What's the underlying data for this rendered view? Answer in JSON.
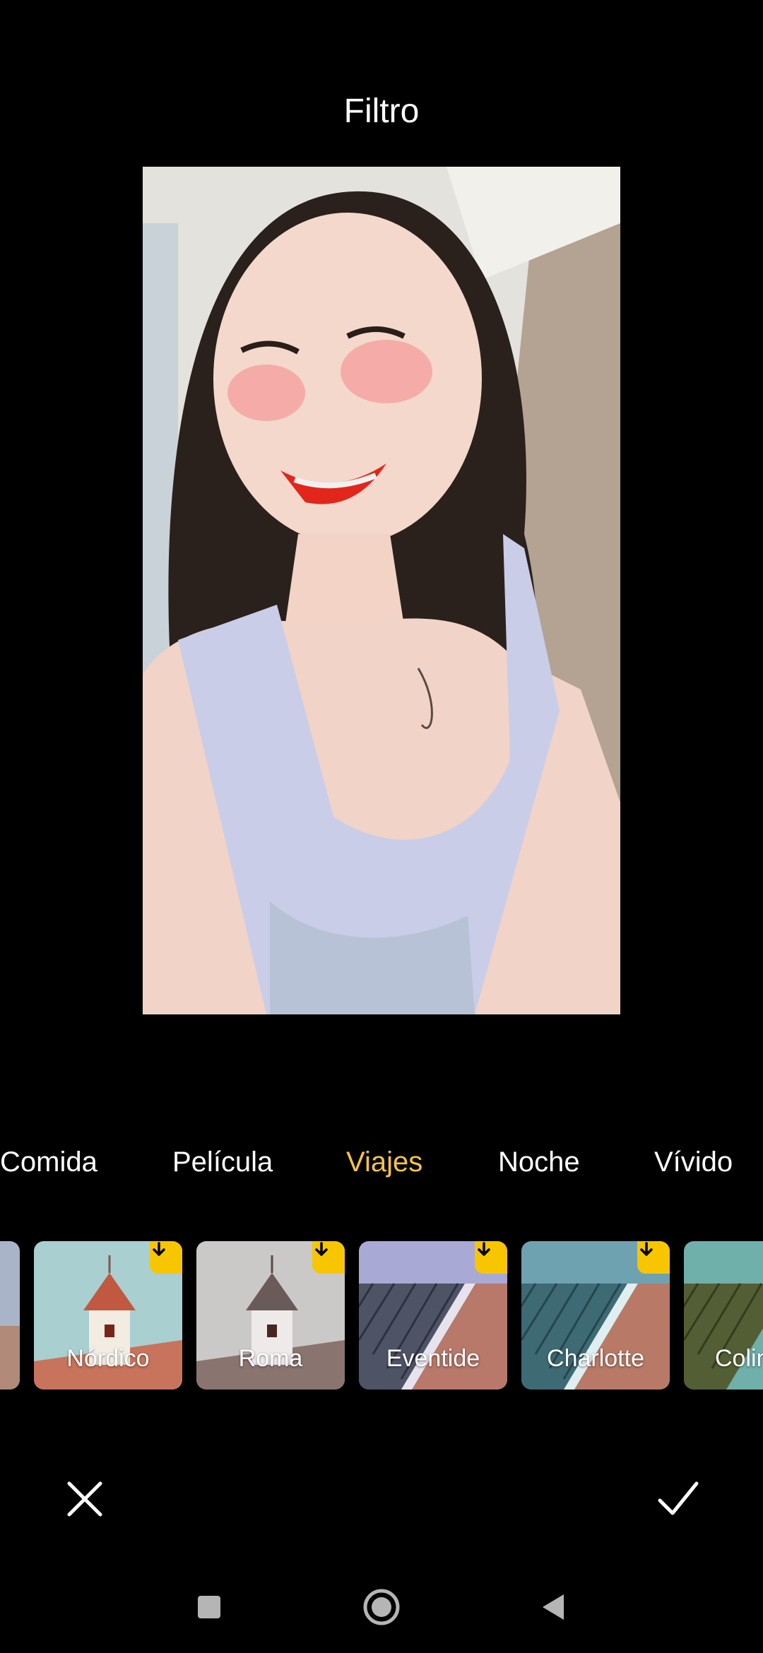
{
  "header": {
    "title": "Filtro"
  },
  "categories": [
    {
      "label": "Comida"
    },
    {
      "label": "Película"
    },
    {
      "label": "Viajes"
    },
    {
      "label": "Noche"
    },
    {
      "label": "Vívido"
    }
  ],
  "active_category": "Viajes",
  "filters": [
    {
      "label": ""
    },
    {
      "label": "Nórdico",
      "download": true
    },
    {
      "label": "Roma",
      "download": true
    },
    {
      "label": "Eventide",
      "download": true
    },
    {
      "label": "Charlotte",
      "download": true
    },
    {
      "label": "Colin"
    }
  ],
  "actions": {
    "cancel_icon": "close-icon",
    "confirm_icon": "check-icon"
  },
  "colors": {
    "background": "#000000",
    "accent": "#f6c445",
    "download_badge": "#f7c600"
  },
  "system_nav": {
    "recents_icon": "square-icon",
    "home_icon": "circle-icon",
    "back_icon": "triangle-back-icon"
  }
}
